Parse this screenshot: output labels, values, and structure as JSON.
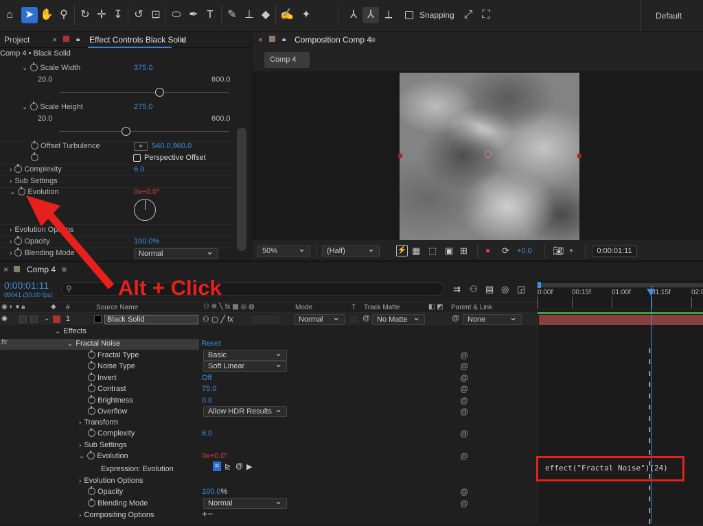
{
  "toolbar": {
    "snapping": "Snapping",
    "workspace": "Default"
  },
  "effect_panel": {
    "tab_project": "Project",
    "tab_effect": "Effect Controls Black Solid",
    "breadcrumb": "Comp 4 • Black Solid",
    "scale_width": {
      "label": "Scale Width",
      "value": "375.0",
      "min": "20.0",
      "max": "600.0",
      "level": 0.61
    },
    "scale_height": {
      "label": "Scale Height",
      "value": "275.0",
      "min": "20.0",
      "max": "600.0",
      "level": 0.44
    },
    "offset_turbulence": {
      "label": "Offset Turbulence",
      "value": "540.0,960.0"
    },
    "perspective_offset": "Perspective Offset",
    "complexity": {
      "label": "Complexity",
      "value": "6.0"
    },
    "sub_settings": "Sub Settings",
    "evolution": {
      "label": "Evolution",
      "value_x": "0x",
      "value_deg": "+0.0°"
    },
    "evolution_options": "Evolution Options",
    "opacity": {
      "label": "Opacity",
      "value": "100.0%"
    },
    "blending": {
      "label": "Blending Mode",
      "value": "Normal"
    }
  },
  "comp_panel": {
    "tab": "Composition Comp 4",
    "chip": "Comp 4",
    "zoom": "50%",
    "resolution": "(Half)",
    "exposure": "+0.0",
    "timecode": "0:00:01:11"
  },
  "timeline": {
    "tab": "Comp 4",
    "timecode": "0:00:01:11",
    "frames": "00041 (30.00 fps)",
    "search_placeholder": "",
    "col_num": "#",
    "col_source": "Source Name",
    "col_mode": "Mode",
    "col_t": "T",
    "col_matte": "Track Matte",
    "col_parent": "Parent & Link",
    "layer": {
      "num": "1",
      "name": "Black Solid",
      "mode": "Normal",
      "matte": "No Matte",
      "parent": "None"
    },
    "effects": "Effects",
    "fractal": "Fractal Noise",
    "reset": "Reset",
    "props": [
      {
        "label": "Fractal Type",
        "dd": "Basic"
      },
      {
        "label": "Noise Type",
        "dd": "Soft Linear"
      },
      {
        "label": "Invert",
        "val": "Off"
      },
      {
        "label": "Contrast",
        "val": "75.0"
      },
      {
        "label": "Brightness",
        "val": "0.0"
      },
      {
        "label": "Overflow",
        "dd": "Allow HDR Results"
      }
    ],
    "transform": "Transform",
    "complexity": {
      "label": "Complexity",
      "value": "6.0"
    },
    "sub_settings": "Sub Settings",
    "evolution": {
      "label": "Evolution",
      "value_x": "0x",
      "value_deg": "+0.0°"
    },
    "expression_label": "Expression: Evolution",
    "evolution_options": "Evolution Options",
    "opacity": {
      "label": "Opacity",
      "value": "100.0",
      "unit": "%"
    },
    "blending": {
      "label": "Blending Mode",
      "value": "Normal"
    },
    "compositing": "Compositing Options",
    "ruler": [
      "0:00f",
      "00:15f",
      "01:00f",
      "01:15f",
      "02:0"
    ],
    "expression_code": "effect(\"Fractal Noise\")(24)"
  },
  "annotation": {
    "text": "Alt + Click"
  },
  "colors": {
    "accent": "#2d6fd3",
    "annotation": "#e8201c",
    "layer_bar": "#8a3f3f"
  }
}
